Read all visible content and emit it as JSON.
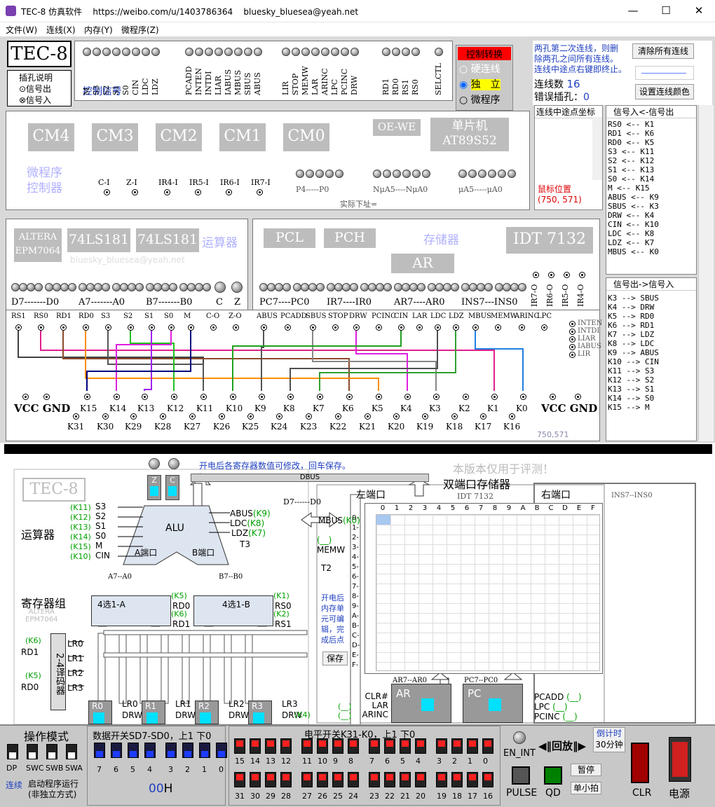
{
  "window": {
    "title": "TEC-8 仿真软件",
    "url": "https://weibo.com/u/1403786364",
    "email": "bluesky_bluesea@yeah.net",
    "min": "—",
    "max": "☐",
    "close": "✕"
  },
  "menu": [
    "文件(W)",
    "连线(X)",
    "内存(Y)",
    "微程序(Z)"
  ],
  "logo": "TEC-8",
  "legend": {
    "title": "插孔说明",
    "out": "⊙信号出",
    "in": "⊗信号入"
  },
  "control": {
    "label": "控制信号",
    "g1": [
      "M",
      "S3",
      "S2",
      "S1",
      "S0",
      "CIN",
      "LDC",
      "LDZ"
    ],
    "g2": [
      "PCADD",
      "INTEN",
      "INTDI",
      "LIAR",
      "IABUS",
      "MBUS",
      "SBUS",
      "ABUS"
    ],
    "g3": [
      "LIR",
      "STOP",
      "MEMW",
      "LAR",
      "ARINC",
      "LPC",
      "PCINC",
      "DRW"
    ],
    "g4": [
      "RD1",
      "RD0",
      "RS1",
      "RS0"
    ],
    "g5": [
      "SELCTL"
    ]
  },
  "mode": {
    "title": "控制转换",
    "opt1": "硬连线",
    "opt2": "独　立",
    "opt3": "微程序"
  },
  "info": {
    "line1": "两孔第二次连线，则删",
    "line2": "除两孔之间所有连线。",
    "line3": "连线中途点右键即终止。",
    "clear": "清除所有连线",
    "count_label": "连线数",
    "count": "16",
    "err_label": "错误插孔：",
    "err": "0",
    "color": "设置连线颜色",
    "mid": "连线中途点坐标",
    "mouse_label": "鼠标位置",
    "mouse": "(750, 571)",
    "coord": "750,571"
  },
  "in_title": "信号入<-信号出",
  "in_list": [
    "RS0 <-- K1",
    "RD1 <-- K6",
    "RD0 <-- K5",
    "S3 <-- K11",
    "S2 <-- K12",
    "S1 <-- K13",
    "S0 <-- K14",
    "M <-- K15",
    "ABUS <-- K9",
    "SBUS <-- K3",
    "DRW <-- K4",
    "CIN <-- K10",
    "LDC <-- K8",
    "LDZ <-- K7",
    "MBUS <-- K0"
  ],
  "out_title": "信号出->信号入",
  "out_list": [
    "K3 --> SBUS",
    "K4 --> DRW",
    "K5 --> RD0",
    "K6 --> RD1",
    "K7 --> LDZ",
    "K8 --> LDC",
    "K9 --> ABUS",
    "K10 --> CIN",
    "K11 --> S3",
    "K12 --> S2",
    "K13 --> S1",
    "K14 --> S0",
    "K15 --> M"
  ],
  "cm": [
    "CM4",
    "CM3",
    "CM2",
    "CM1",
    "CM0"
  ],
  "oewe": "OE-WE",
  "mcu": "单片机",
  "mcu2": "AT89S52",
  "micro_ctrl": "微程序",
  "micro_ctrl2": "控制器",
  "intr": [
    "C-I",
    "Z-I",
    "IR4-I",
    "IR5-I",
    "IR6-I",
    "IR7-I"
  ],
  "addr": [
    "P4-----P0",
    "NμA5----NμA0",
    "μA5-----μA0"
  ],
  "actual": "实际下址=",
  "alu": {
    "altera": "ALTERA",
    "epm": "EPM7064",
    "c1": "74LS181",
    "c2": "74LS181",
    "title": "运算器",
    "d": "D7-------D0",
    "a": "A7-------A0",
    "b": "B7-------B0",
    "c": "C",
    "z": "Z",
    "wm": "bluesky_bluesea@yeah.net"
  },
  "mem": {
    "pcl": "PCL",
    "pch": "PCH",
    "title": "存储器",
    "idt": "IDT 7132",
    "ar": "AR",
    "pc": "PC7----PC0",
    "ir": "IR7----IR0",
    "arl": "AR7----AR0",
    "ins": "INS7---INS0",
    "iro": [
      "IR7-O",
      "IR6-O",
      "IR5-O",
      "IR4-O"
    ]
  },
  "sigrow": [
    "RS1",
    "RS0",
    "RD1",
    "RD0",
    "S3",
    "S2",
    "S1",
    "S0",
    "M",
    "C-O",
    "Z-O",
    "ABUS",
    "PCADD",
    "SBUS",
    "STOP",
    "DRW",
    "PCINC",
    "CIN",
    "LAR",
    "LDC",
    "LDZ",
    "MBUS",
    "MEMW",
    "ARINC",
    "LPC"
  ],
  "intrin": [
    "INTEN",
    "INTDI",
    "LIAR",
    "IABUS",
    "LIR"
  ],
  "k_top": [
    "K15",
    "K14",
    "K13",
    "K12",
    "K11",
    "K10",
    "K9",
    "K8",
    "K7",
    "K6",
    "K5",
    "K4",
    "K3",
    "K2",
    "K1",
    "K0"
  ],
  "k_bot": [
    "K31",
    "K30",
    "K29",
    "K28",
    "K27",
    "K26",
    "K25",
    "K24",
    "K23",
    "K22",
    "K21",
    "K20",
    "K19",
    "K18",
    "K17",
    "K16"
  ],
  "vcc": "VCC",
  "gnd": "GND",
  "diag": {
    "logo": "TEC-8",
    "note": "开电后各寄存器数值可修改，回车保存。",
    "eval": "本版本仅用于评测！",
    "dbus": "DBUS",
    "d70": "D7------D0",
    "dual": "双端口存储器",
    "idt": "IDT 7132",
    "left": "左端口",
    "right": "右端口",
    "ins": "INS7--INS0",
    "alu_title": "运算器",
    "alu": "ALU",
    "aport": "A端口",
    "bport": "B端口",
    "z": "Z",
    "c": "C",
    "abus": "ABUS",
    "ldc": "LDC",
    "ldz": "LDZ",
    "t3": "T3",
    "regs": "寄存器组",
    "sel_a": "4选1-A",
    "sel_b": "4选1-B",
    "a70": "A7--A0",
    "b70": "B7--B0",
    "rd0": "RD0",
    "rd1": "RD1",
    "rs0": "RS0",
    "rs1": "RS1",
    "dec": "2-4译码器",
    "lr": [
      "LR0",
      "LR1",
      "LR2",
      "LR3"
    ],
    "r": [
      "R0",
      "R1",
      "R2",
      "R3"
    ],
    "drw": "DRW",
    "mbus": "MBUS",
    "memw": "MEMW",
    "t2": "T2",
    "memnote": "开电后内存单元可编辑，完成后点",
    "save": "保存",
    "clr": "CLR#",
    "lar": "LAR",
    "arinc": "ARINC",
    "ar": "AR",
    "ar70": "AR7--AR0",
    "pc": "PC",
    "pc70": "PC7--PC0",
    "pcadd": "PCADD",
    "lpc": "LPC",
    "pcinc": "PCINC",
    "altera": "ALTERA",
    "epm": "EPM7064",
    "kl": {
      "s3": "(K11)",
      "s2": "(K12)",
      "s1": "(K13)",
      "s0": "(K14)",
      "m": "(K15)",
      "cin": "(K10)",
      "abus": "(K9)",
      "ldc": "(K8)",
      "ldz": "(K7)",
      "rd0": "(K5)",
      "rd1": "(K6)",
      "rs0": "(K1)",
      "rs1": "(K2)",
      "rd1b": "(K6)",
      "rd0b": "(K5)",
      "drw": "(K4)",
      "mbus": "(K0)",
      "memw": "(__)",
      "lar": "(__)",
      "arinc": "(__)",
      "pcadd": "(__)",
      "lpc": "(__)",
      "pcinc": "(__)"
    },
    "s3": "S3",
    "s2": "S2",
    "s1": "S1",
    "s0": "S0",
    "m": "M",
    "cin": "CIN"
  },
  "memgrid": {
    "cols": [
      "0",
      "1",
      "2",
      "3",
      "4",
      "5",
      "6",
      "7",
      "8",
      "9",
      "A",
      "B",
      "C",
      "D",
      "E",
      "F"
    ],
    "rows": [
      "0-",
      "1-",
      "2-",
      "3-",
      "4-",
      "5-",
      "6-",
      "7-",
      "8-",
      "9-",
      "A-",
      "B-",
      "C-",
      "D-",
      "E-",
      "F-"
    ]
  },
  "bottom": {
    "opmode": "操作模式",
    "sw": [
      "DP",
      "SWC",
      "SWB",
      "SWA"
    ],
    "lianxu": "连续",
    "startrun": "启动程序运行",
    "nonind": "(非独立方式)",
    "data": "数据开关SD7-SD0，上1 下0",
    "dlabels": [
      "7",
      "6",
      "5",
      "4",
      "3",
      "2",
      "1",
      "0"
    ],
    "hex": "00",
    "h": "H",
    "level": "电平开关K31-K0，上1 下0",
    "top_nums": [
      "15",
      "14",
      "13",
      "12",
      "11",
      "10",
      "9",
      "8",
      "7",
      "6",
      "5",
      "4",
      "3",
      "2",
      "1",
      "0"
    ],
    "bot_nums": [
      "31",
      "30",
      "29",
      "28",
      "27",
      "26",
      "25",
      "24",
      "23",
      "22",
      "21",
      "20",
      "19",
      "18",
      "17",
      "16"
    ],
    "enint": "EN_INT",
    "play": "◀‖回放‖▶",
    "timer": "倒计时",
    "min30": "30分钟",
    "pause": "暂停",
    "pulse": "PULSE",
    "qd": "QD",
    "step": "单小拍",
    "clr": "CLR",
    "power": "电源"
  }
}
